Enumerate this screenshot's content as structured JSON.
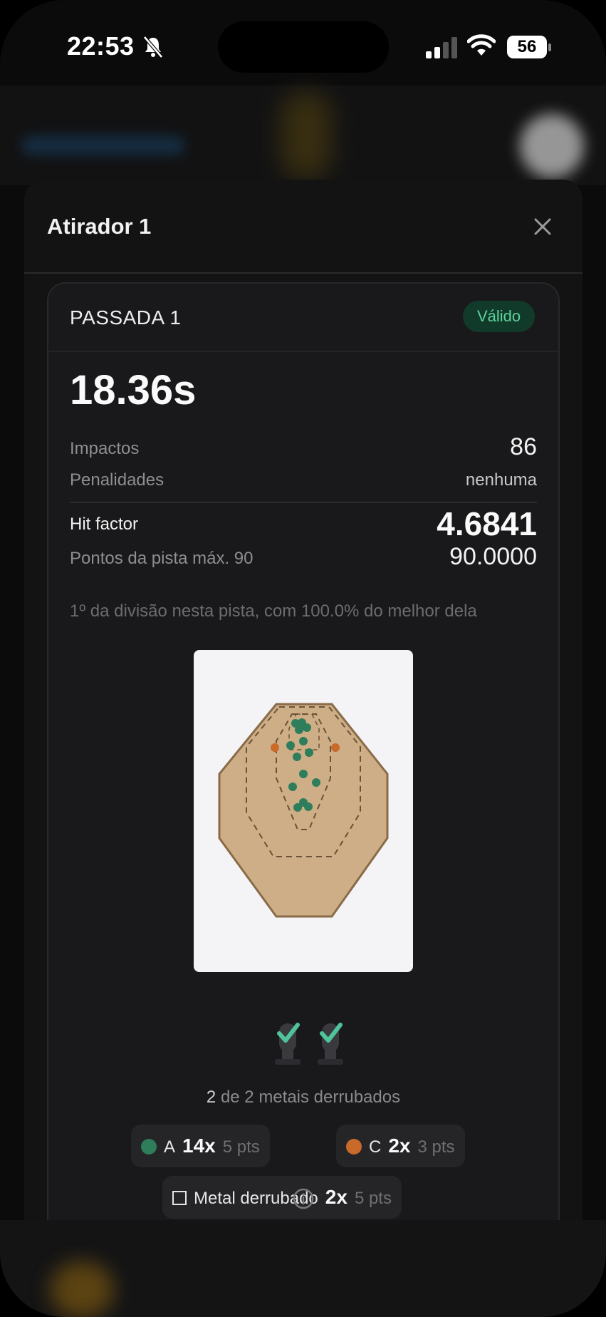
{
  "status_bar": {
    "time": "22:53",
    "battery": "56",
    "icons": [
      "bell-slash-icon",
      "signal-icon",
      "wifi-icon",
      "battery-icon"
    ]
  },
  "modal": {
    "title": "Atirador 1",
    "close_icon": "close-icon"
  },
  "run": {
    "title": "PASSADA 1",
    "status": "Válido",
    "time": "18.36s",
    "impacts_label": "Impactos",
    "impacts_value": "86",
    "penalties_label": "Penalidades",
    "penalties_value": "nenhuma",
    "hit_factor_label": "Hit factor",
    "hit_factor_value": "4.6841",
    "points_label": "Pontos da pista máx. 90",
    "points_value": "90.0000",
    "note": "1º da divisão nesta pista, com 100.0% do melhor dela"
  },
  "metals": {
    "down": "2",
    "text": "de 2 metais derrubados"
  },
  "legend": [
    {
      "letter": "A",
      "count": "14x",
      "pts": "5 pts",
      "color": "#2e7d5b"
    },
    {
      "letter": "C",
      "count": "2x",
      "pts": "3 pts",
      "color": "#c9692a"
    }
  ],
  "metal_legend": {
    "label": "Metal derrubado",
    "count": "2x",
    "pts": "5 pts"
  },
  "colors": {
    "accent_valid": "#5dd39b",
    "target_fill": "#cdae86",
    "target_stroke": "#8a6b48",
    "hit_a": "#2e7d5b",
    "hit_c": "#c9692a"
  }
}
